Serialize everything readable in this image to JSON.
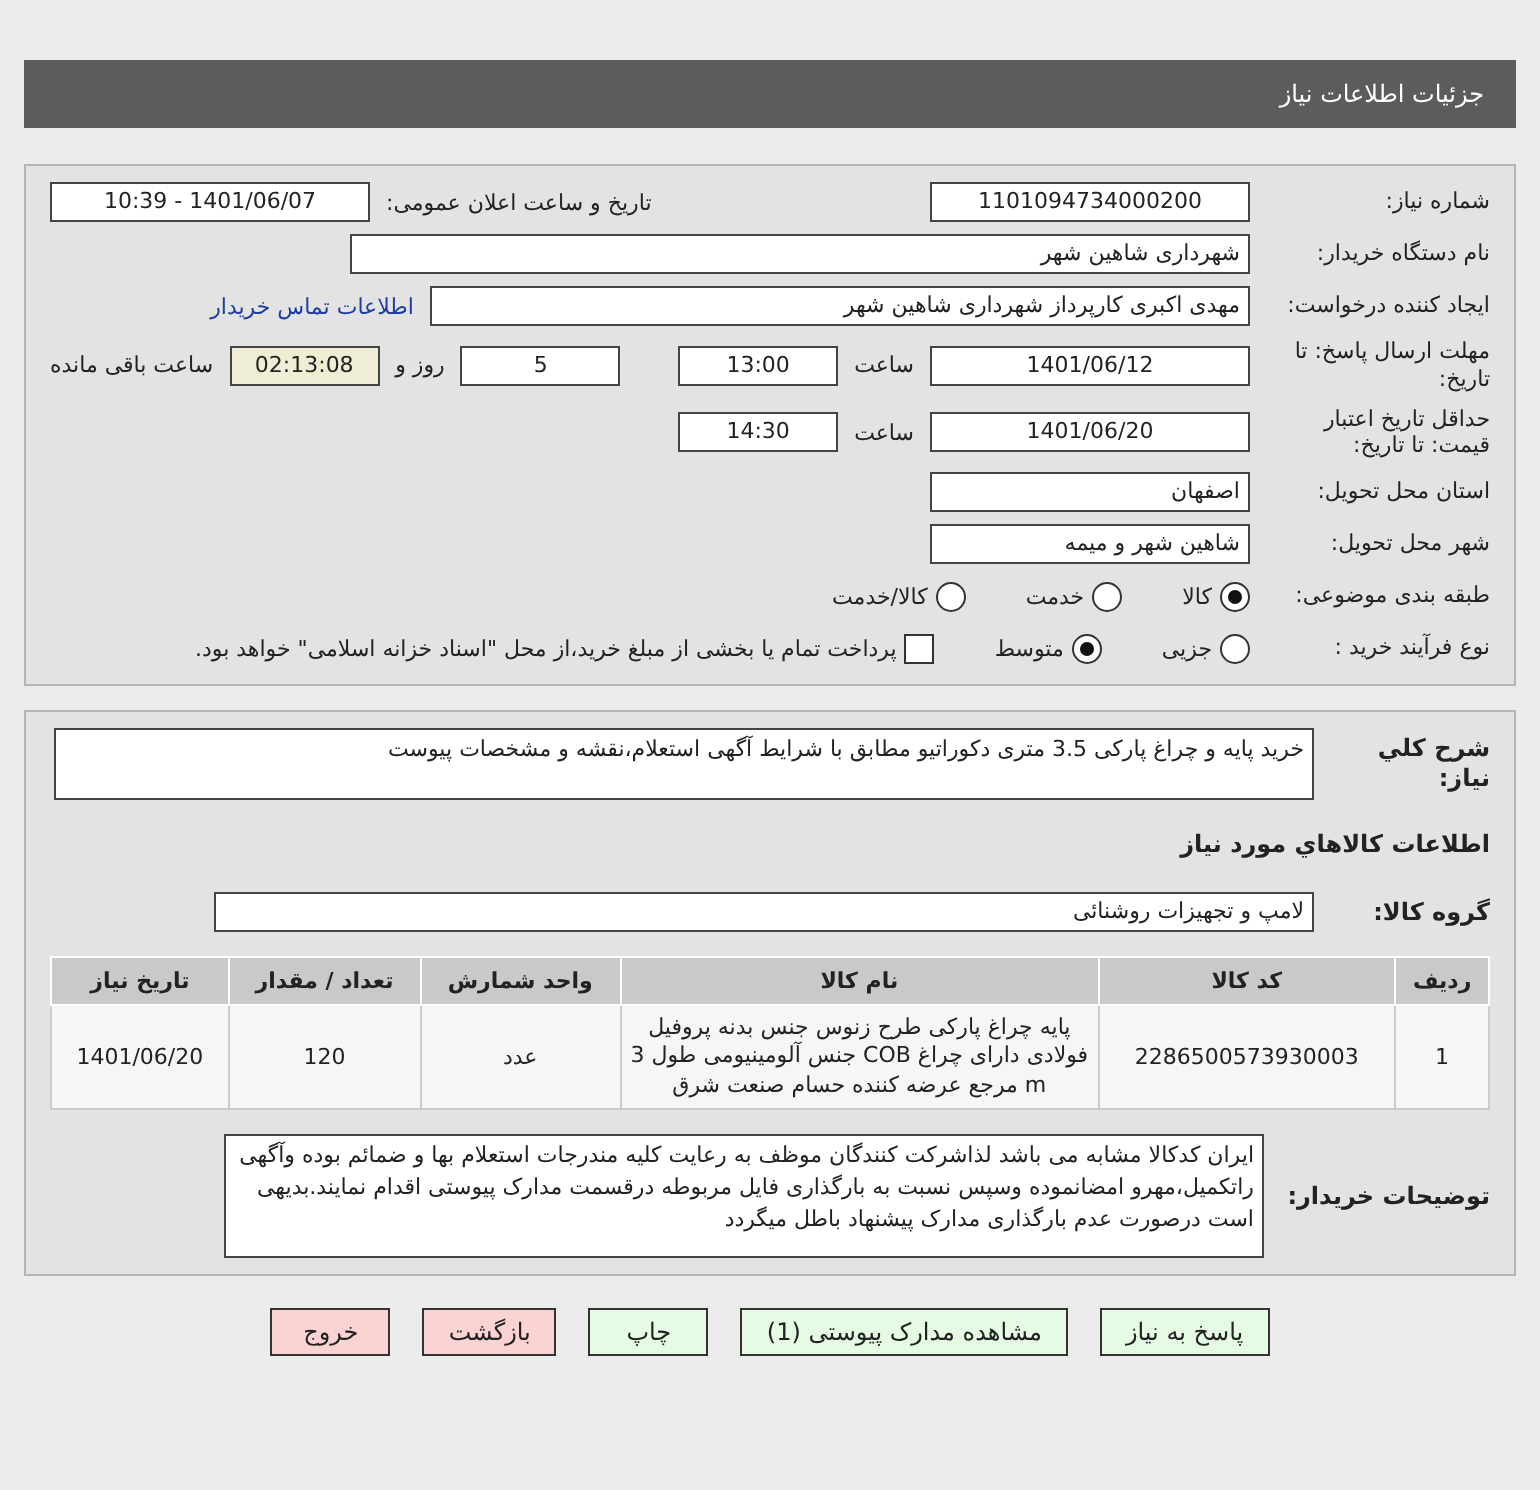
{
  "header": {
    "title": "جزئیات اطلاعات نیاز"
  },
  "need_number": {
    "label": "شماره نیاز:",
    "value": "1101094734000200"
  },
  "announce": {
    "label": "تاریخ و ساعت اعلان عمومی:",
    "value": "1401/06/07 - 10:39"
  },
  "buyer_org": {
    "label": "نام دستگاه خریدار:",
    "value": "شهرداری شاهین شهر"
  },
  "creator": {
    "label": "ایجاد کننده درخواست:",
    "value": "مهدی اکبری کارپرداز شهرداری شاهین شهر",
    "link": "اطلاعات تماس خریدار"
  },
  "deadline": {
    "label": "مهلت ارسال پاسخ: تا تاریخ:",
    "date": "1401/06/12",
    "time_label": "ساعت",
    "time": "13:00",
    "days": "5",
    "days_label": "روز و",
    "remaining": "02:13:08",
    "remaining_label": "ساعت باقی مانده"
  },
  "validity": {
    "label": "حداقل تاریخ اعتبار قیمت: تا تاریخ:",
    "date": "1401/06/20",
    "time_label": "ساعت",
    "time": "14:30"
  },
  "province": {
    "label": "استان محل تحویل:",
    "value": "اصفهان"
  },
  "city": {
    "label": "شهر محل تحویل:",
    "value": "شاهین شهر و میمه"
  },
  "category": {
    "label": "طبقه بندی موضوعی:",
    "options": [
      {
        "label": "کالا",
        "selected": true
      },
      {
        "label": "خدمت",
        "selected": false
      },
      {
        "label": "کالا/خدمت",
        "selected": false
      }
    ]
  },
  "process": {
    "label": "نوع فرآیند خرید :",
    "options": [
      {
        "label": "جزیی",
        "selected": false
      },
      {
        "label": "متوسط",
        "selected": true
      }
    ],
    "payment": {
      "label": "پرداخت تمام یا بخشی از مبلغ خرید،از محل \"اسناد خزانه اسلامی\" خواهد بود.",
      "checked": false
    }
  },
  "summary": {
    "label": "شرح کلي نياز:",
    "value": "خرید پایه و چراغ پارکی 3.5 متری دکوراتیو مطابق با شرایط آگهی استعلام،نقشه و مشخصات پیوست"
  },
  "goods_title": "اطلاعات کالاهاي مورد نياز",
  "goods_group": {
    "label": "گروه کالا:",
    "value": "لامپ و تجهیزات روشنائی"
  },
  "table": {
    "columns": [
      "ردیف",
      "کد کالا",
      "نام کالا",
      "واحد شمارش",
      "تعداد / مقدار",
      "تاریخ نیاز"
    ],
    "rows": [
      [
        "1",
        "2286500573930003",
        "پایه چراغ پارکی طرح زنوس جنس بدنه پروفیل فولادی دارای چراغ COB جنس آلومینیومی طول 3 m مرجع عرضه کننده حسام صنعت شرق",
        "عدد",
        "120",
        "1401/06/20"
      ]
    ]
  },
  "buyer_notes": {
    "label": "توضیحات خریدار:",
    "value": "ایران کدکالا مشابه می باشد لذاشرکت کنندگان موظف به رعایت کلیه مندرجات استعلام بها و ضمائم بوده وآگهی راتکمیل،مهرو امضانموده وسپس نسبت به بارگذاری فایل مربوطه درقسمت مدارک پیوستی اقدام نمایند.بدیهی است درصورت عدم بارگذاری مدارک پیشنهاد باطل میگردد"
  },
  "buttons": [
    {
      "label": "پاسخ به نیاز",
      "kind": "normal"
    },
    {
      "label": "مشاهده مدارک پیوستی (1)",
      "kind": "normal"
    },
    {
      "label": "چاپ",
      "kind": "normal"
    },
    {
      "label": "بازگشت",
      "kind": "warning"
    },
    {
      "label": "خروج",
      "kind": "warning"
    }
  ]
}
